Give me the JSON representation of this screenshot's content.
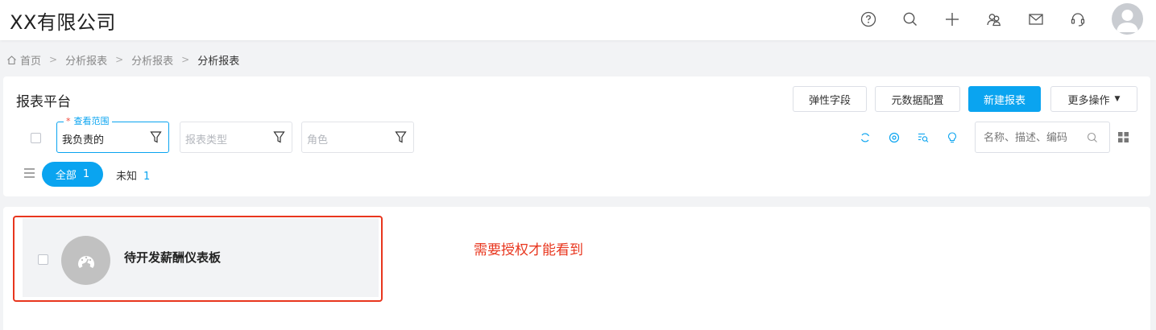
{
  "header": {
    "company": "XX有限公司",
    "icons": [
      "help-icon",
      "search-icon",
      "plus-icon",
      "team-icon",
      "mail-icon",
      "headset-icon",
      "user-avatar"
    ]
  },
  "breadcrumb": {
    "items": [
      "首页",
      "分析报表",
      "分析报表",
      "分析报表"
    ]
  },
  "panel": {
    "title": "报表平台",
    "buttons": {
      "flex_field": "弹性字段",
      "metadata_config": "元数据配置",
      "new_report": "新建报表",
      "more_actions": "更多操作"
    },
    "filters": {
      "scope_label": "查看范围",
      "scope_required": "*",
      "scope_value": "我负责的",
      "type_placeholder": "报表类型",
      "role_placeholder": "角色"
    },
    "search": {
      "placeholder": "名称、描述、编码"
    },
    "tabs": {
      "all_label": "全部",
      "all_count": "1",
      "unknown_label": "未知",
      "unknown_count": "1"
    }
  },
  "cards": [
    {
      "title": "待开发薪酬仪表板",
      "icon": "dashboard-gauge-icon"
    }
  ],
  "annotation": {
    "note": "需要授权才能看到"
  },
  "colors": {
    "primary": "#0aa4f0",
    "annotation_red": "#e8361e",
    "background": "#f2f3f5"
  }
}
